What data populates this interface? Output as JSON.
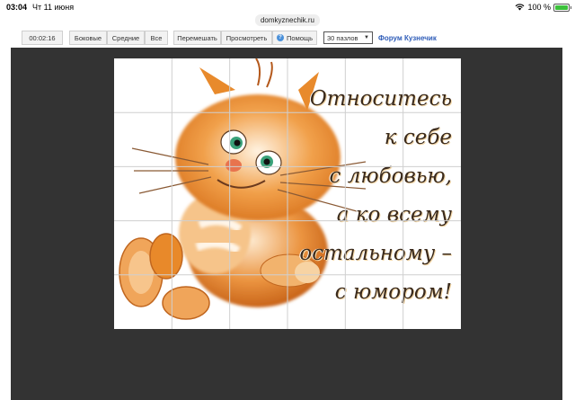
{
  "status_bar": {
    "time": "03:04",
    "date": "Чт 11 июня",
    "battery": "100 %",
    "battery_level": 1.0,
    "url": "domkyznechik.ru"
  },
  "toolbar": {
    "timer": "00:02:16",
    "side_label": "Боковые",
    "middle_label": "Средние",
    "all_label": "Все",
    "shuffle_label": "Перемешать",
    "view_label": "Просмотреть",
    "help_label": "Помощь",
    "pieces_select": "30 пазлов",
    "forum_link": "Форум Кузнечик"
  },
  "puzzle": {
    "quote_lines": [
      "Относитесь",
      "к себе",
      "с любовью,",
      "а ко всему",
      "остальному –",
      "с юмором!"
    ],
    "columns": 6,
    "rows": 5
  },
  "colors": {
    "stage": "#333333",
    "link": "#2e5cb8",
    "cat_orange": "#e8892a"
  }
}
